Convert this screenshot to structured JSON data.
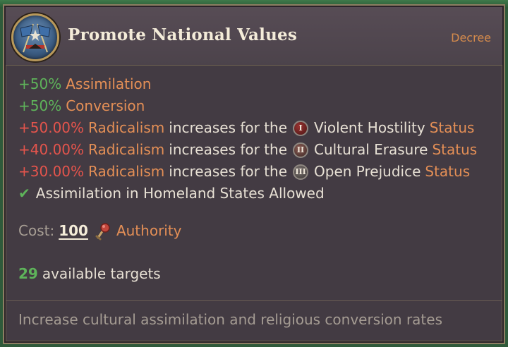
{
  "tooltip": {
    "title": "Promote National Values",
    "type": "Decree",
    "effects": [
      {
        "value": "+50%",
        "label": "Assimilation"
      },
      {
        "value": "+50%",
        "label": "Conversion"
      }
    ],
    "radicalism": [
      {
        "value": "+50.00%",
        "label": "Radicalism",
        "text": "increases for the",
        "numeral": "I",
        "status_name": "Violent Hostility",
        "status_word": "Status"
      },
      {
        "value": "+40.00%",
        "label": "Radicalism",
        "text": "increases for the",
        "numeral": "II",
        "status_name": "Cultural Erasure",
        "status_word": "Status"
      },
      {
        "value": "+30.00%",
        "label": "Radicalism",
        "text": "increases for the",
        "numeral": "III",
        "status_name": "Open Prejudice",
        "status_word": "Status"
      }
    ],
    "allowed": {
      "icon": "checkmark-icon",
      "text": "Assimilation in Homeland States Allowed"
    },
    "cost": {
      "label": "Cost:",
      "value": "100",
      "icon": "authority-icon",
      "resource": "Authority"
    },
    "targets": {
      "count": "29",
      "text": "available targets"
    },
    "description": "Increase cultural assimilation and religious conversion rates"
  },
  "colors": {
    "positive": "#5eb35a",
    "negative": "#e4544c",
    "highlight": "#e48f56",
    "panel": "#433b43",
    "border": "#8d7f62"
  }
}
